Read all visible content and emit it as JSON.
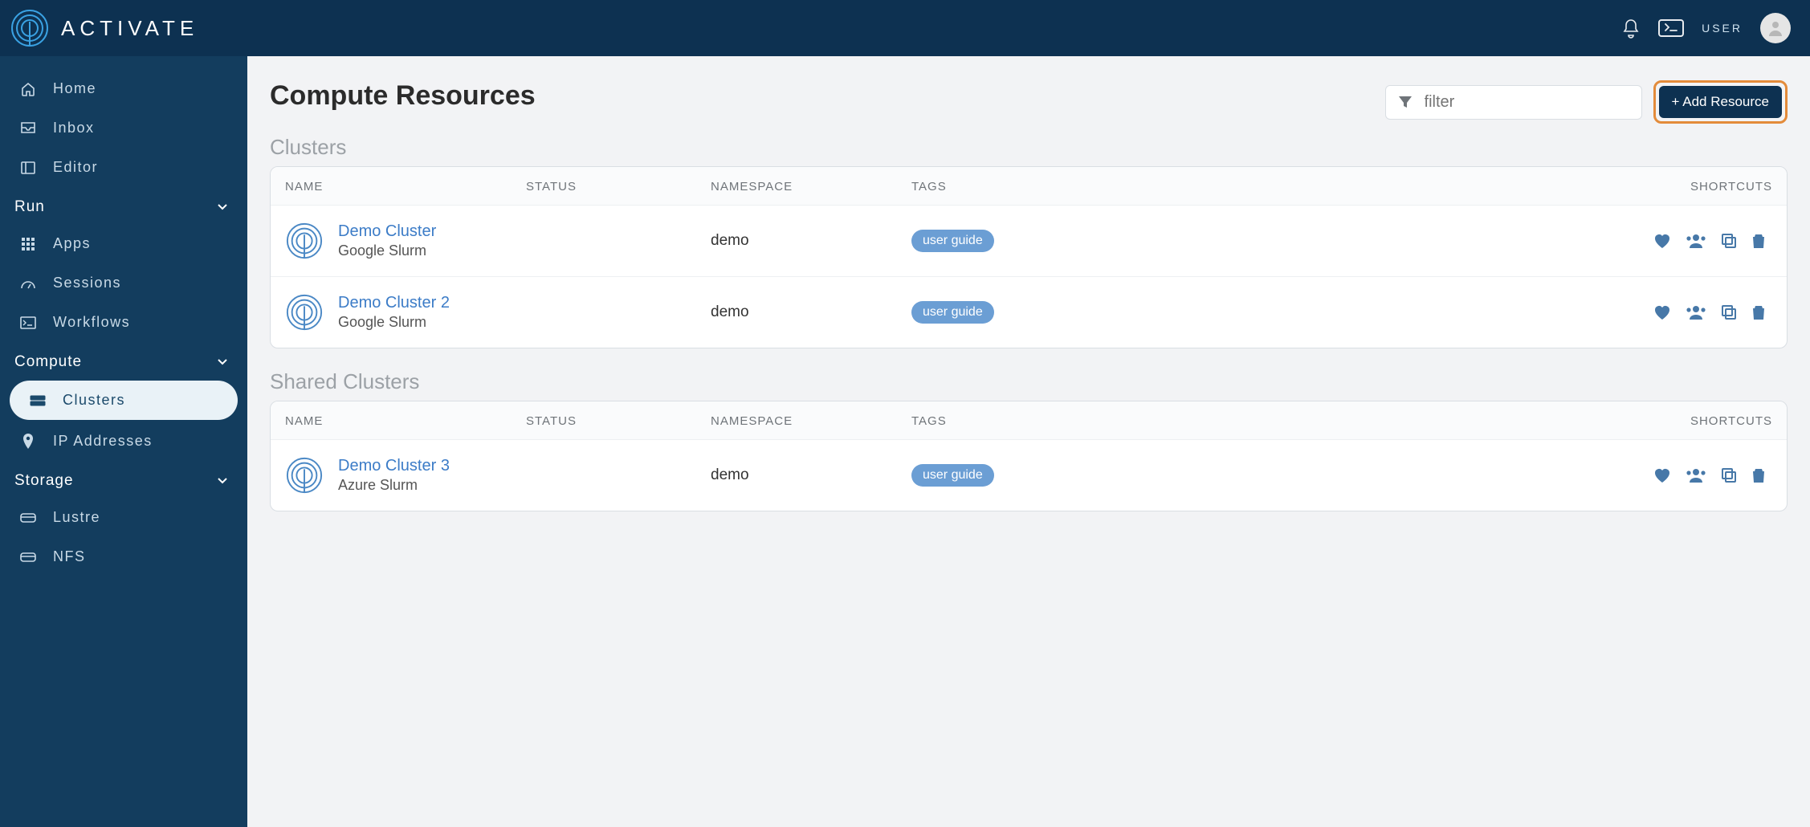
{
  "brand": "ACTIVATE",
  "user_label": "USER",
  "sidebar": {
    "top_items": [
      {
        "icon": "home",
        "label": "Home"
      },
      {
        "icon": "inbox",
        "label": "Inbox"
      },
      {
        "icon": "editor",
        "label": "Editor"
      }
    ],
    "sections": [
      {
        "title": "Run",
        "items": [
          {
            "icon": "grid",
            "label": "Apps"
          },
          {
            "icon": "gauge",
            "label": "Sessions"
          },
          {
            "icon": "terminal",
            "label": "Workflows"
          }
        ]
      },
      {
        "title": "Compute",
        "items": [
          {
            "icon": "server",
            "label": "Clusters",
            "active": true
          },
          {
            "icon": "pin",
            "label": "IP Addresses"
          }
        ]
      },
      {
        "title": "Storage",
        "items": [
          {
            "icon": "disk",
            "label": "Lustre"
          },
          {
            "icon": "disk",
            "label": "NFS"
          }
        ]
      }
    ]
  },
  "page": {
    "title": "Compute Resources",
    "filter_placeholder": "filter",
    "add_button": "+ Add Resource"
  },
  "columns": {
    "name": "NAME",
    "status": "STATUS",
    "namespace": "NAMESPACE",
    "tags": "TAGS",
    "shortcuts": "SHORTCUTS"
  },
  "sections_data": [
    {
      "title": "Clusters",
      "rows": [
        {
          "name": "Demo Cluster",
          "sub": "Google Slurm",
          "status": "",
          "namespace": "demo",
          "tag": "user guide"
        },
        {
          "name": "Demo Cluster 2",
          "sub": "Google Slurm",
          "status": "",
          "namespace": "demo",
          "tag": "user guide"
        }
      ]
    },
    {
      "title": "Shared Clusters",
      "rows": [
        {
          "name": "Demo Cluster 3",
          "sub": "Azure Slurm",
          "status": "",
          "namespace": "demo",
          "tag": "user guide"
        }
      ]
    }
  ]
}
